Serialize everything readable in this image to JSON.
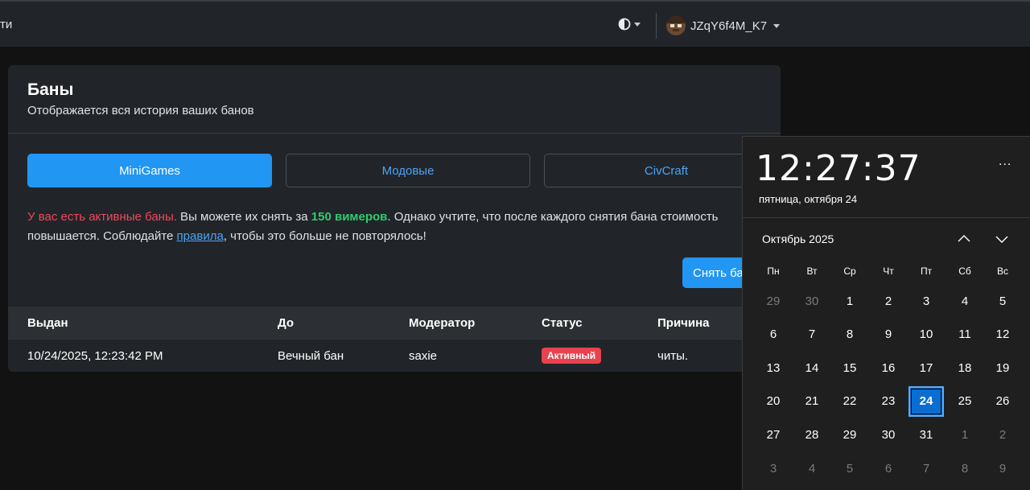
{
  "navbar": {
    "nav_link_partial": "ти",
    "username": "JZqY6f4M_K7"
  },
  "card": {
    "title": "Баны",
    "subtitle": "Отображается вся история ваших банов",
    "tabs": [
      {
        "label": "MiniGames",
        "active": true
      },
      {
        "label": "Модовые",
        "active": false
      },
      {
        "label": "CivCraft",
        "active": false
      }
    ],
    "notice": {
      "warning": "У вас есть активные баны.",
      "text1": " Вы можете их снять за ",
      "price": "150 вимеров",
      "text2": ". Однако учтите, что после каждого снятия бана стоимость повышается. Соблюдайте ",
      "rules_link": "правила",
      "text3": ", чтобы это больше не повторялось!"
    },
    "unban_button": "Снять бан",
    "table": {
      "headers": [
        "Выдан",
        "До",
        "Модератор",
        "Статус",
        "Причина"
      ],
      "rows": [
        {
          "issued": "10/24/2025, 12:23:42 PM",
          "until": "Вечный бан",
          "moderator": "saxie",
          "status": "Активный",
          "reason": "читы."
        }
      ]
    }
  },
  "clock_flyout": {
    "time": "12:27:37",
    "date": "пятница, октября 24",
    "more": "...",
    "month": "Октябрь 2025",
    "weekdays": [
      "Пн",
      "Вт",
      "Ср",
      "Чт",
      "Пт",
      "Сб",
      "Вс"
    ],
    "weeks": [
      [
        "29",
        "30",
        "1",
        "2",
        "3",
        "4",
        "5"
      ],
      [
        "6",
        "7",
        "8",
        "9",
        "10",
        "11",
        "12"
      ],
      [
        "13",
        "14",
        "15",
        "16",
        "17",
        "18",
        "19"
      ],
      [
        "20",
        "21",
        "22",
        "23",
        "24",
        "25",
        "26"
      ],
      [
        "27",
        "28",
        "29",
        "30",
        "31",
        "1",
        "2"
      ],
      [
        "3",
        "4",
        "5",
        "6",
        "7",
        "8",
        "9"
      ]
    ],
    "today": "24"
  },
  "colors": {
    "accent": "#2196f3",
    "danger": "#e8424f",
    "success": "#2ecc71",
    "today_highlight": "#0a6ed1"
  }
}
